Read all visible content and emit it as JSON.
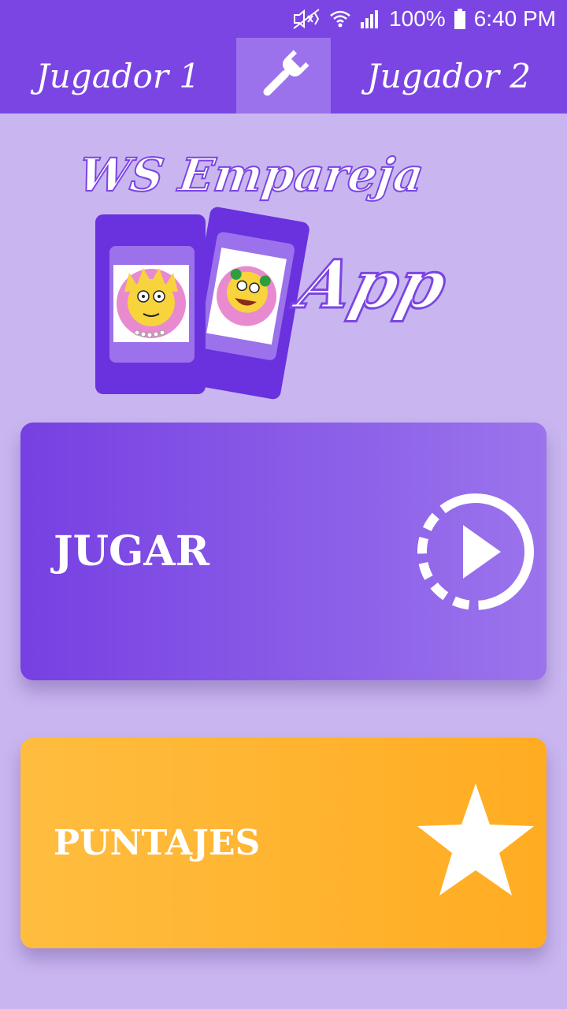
{
  "status_bar": {
    "battery": "100%",
    "time": "6:40 PM",
    "icons": [
      "mute-icon",
      "wifi-icon",
      "signal-icon",
      "battery-icon"
    ]
  },
  "header": {
    "player1": "Jugador 1",
    "player2": "Jugador 2",
    "settings_icon": "wrench-icon"
  },
  "logo": {
    "line1": "WS Empareja",
    "line2": "App"
  },
  "buttons": {
    "play": {
      "label": "JUGAR",
      "icon": "play-circle-icon"
    },
    "scores": {
      "label": "PUNTAJES",
      "icon": "star-icon"
    }
  },
  "colors": {
    "primary": "#7b45e3",
    "background": "#c9b6f0",
    "accent": "#ffb22c",
    "text": "#ffffff"
  }
}
